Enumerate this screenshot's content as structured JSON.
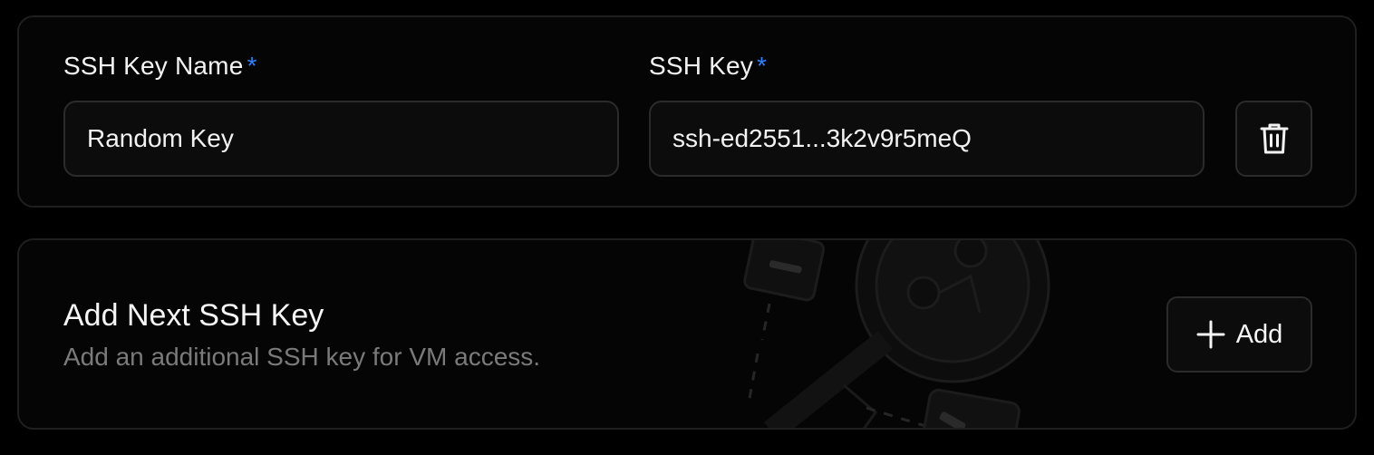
{
  "ssh_key_entry": {
    "name_label": "SSH Key Name",
    "key_label": "SSH Key",
    "required_marker": "*",
    "name_value": "Random Key",
    "key_value": "ssh-ed2551...3k2v9r5meQ",
    "delete_icon": "trash-icon"
  },
  "add_section": {
    "title": "Add Next SSH Key",
    "subtitle": "Add an additional SSH key for VM access.",
    "add_label": "Add",
    "add_icon": "plus-icon"
  },
  "colors": {
    "background": "#000000",
    "card_background": "#050505",
    "border": "#1f1f1f",
    "required": "#2f80ff",
    "muted_text": "#7a7a7a"
  }
}
